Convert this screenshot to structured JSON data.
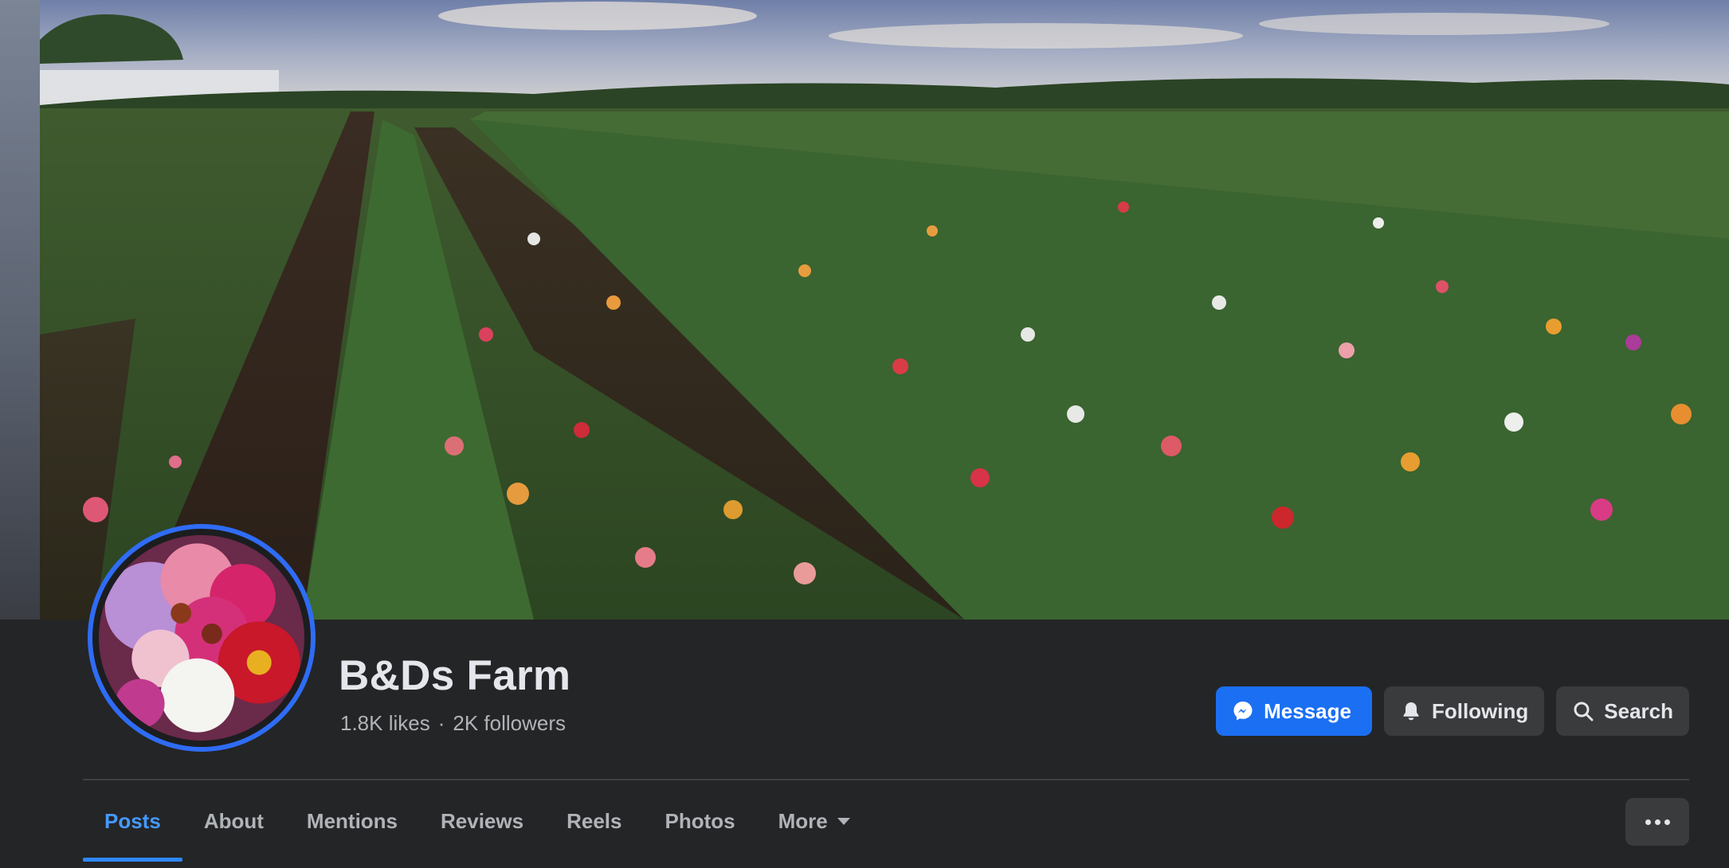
{
  "page": {
    "name": "B&Ds Farm",
    "likes": "1.8K likes",
    "separator": "·",
    "followers": "2K followers"
  },
  "actions": {
    "message_label": "Message",
    "following_label": "Following",
    "search_label": "Search"
  },
  "tabs": [
    {
      "label": "Posts",
      "active": true
    },
    {
      "label": "About"
    },
    {
      "label": "Mentions"
    },
    {
      "label": "Reviews"
    },
    {
      "label": "Reels"
    },
    {
      "label": "Photos"
    },
    {
      "label": "More"
    }
  ],
  "icons": {
    "message": "messenger-icon",
    "following": "bell-icon",
    "search": "search-icon",
    "more_tab": "caret-down-icon",
    "options": "ellipsis-icon"
  },
  "colors": {
    "accent": "#1b6ff2",
    "active_tab": "#4599ff",
    "avatar_ring": "#2f6cf5",
    "background": "#242526"
  }
}
